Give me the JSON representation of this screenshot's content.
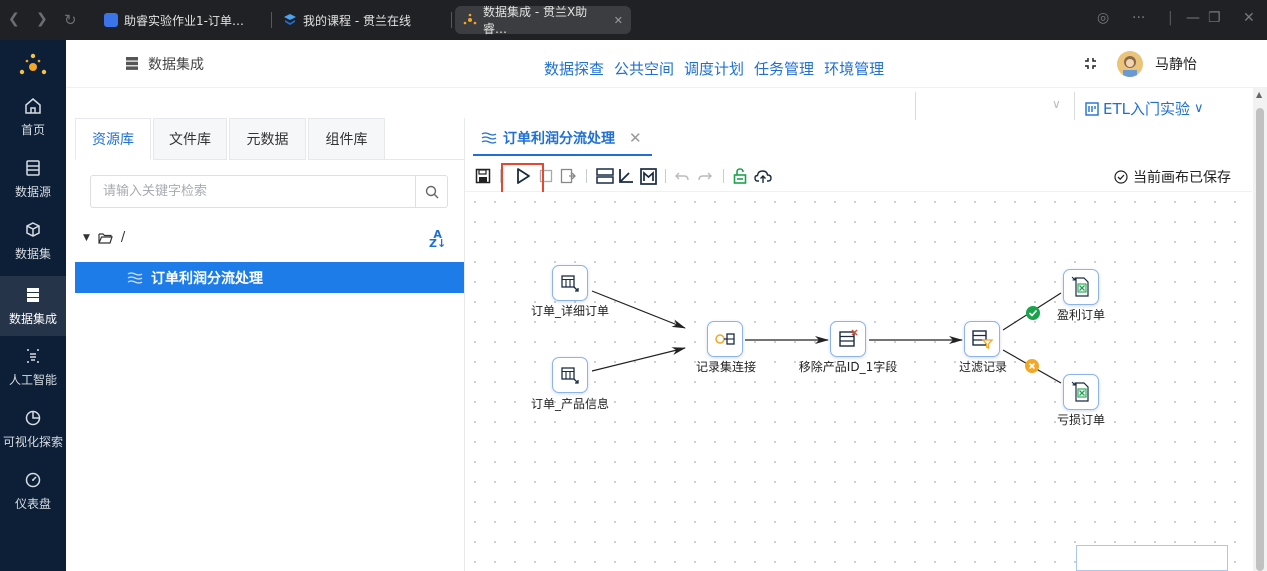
{
  "browser": {
    "tabs": [
      {
        "title": "助睿实验作业1-订单…",
        "active": false
      },
      {
        "title": "我的课程 - 贯兰在线",
        "active": false
      },
      {
        "title": "数据集成 - 贯兰X助睿…",
        "active": true
      }
    ]
  },
  "sidebar": {
    "items": [
      {
        "label": "首页",
        "icon": "home-icon"
      },
      {
        "label": "数据源",
        "icon": "datasource-icon"
      },
      {
        "label": "数据集",
        "icon": "cube-icon"
      },
      {
        "label": "数据集成",
        "icon": "server-icon",
        "active": true
      },
      {
        "label": "人工智能",
        "icon": "ai-icon"
      },
      {
        "label": "可视化探索",
        "icon": "pie-chart-icon"
      },
      {
        "label": "仪表盘",
        "icon": "gauge-icon"
      }
    ]
  },
  "header": {
    "page_title": "数据集成",
    "user_name": "马静怡",
    "menu": [
      "数据探查",
      "公共空间",
      "调度计划",
      "任务管理",
      "环境管理"
    ],
    "project": "ETL入门实验"
  },
  "left_panel": {
    "tabs": [
      "资源库",
      "文件库",
      "元数据",
      "组件库"
    ],
    "active_tab": "资源库",
    "search_placeholder": "请输入关键字检索",
    "tree_root": "/",
    "tree_item": "订单利润分流处理"
  },
  "editor": {
    "tab_title": "订单利润分流处理",
    "saved_status": "当前画布已保存",
    "nodes": [
      {
        "label": "订单_详细订单"
      },
      {
        "label": "订单_产品信息"
      },
      {
        "label": "记录集连接"
      },
      {
        "label": "移除产品ID_1字段"
      },
      {
        "label": "过滤记录"
      },
      {
        "label": "盈利订单"
      },
      {
        "label": "亏损订单"
      }
    ]
  },
  "colors": {
    "accent": "#1f6fd6",
    "sidebar_bg": "#0d1f36",
    "selected_item": "#1e7ce8",
    "highlight_box": "#e8462d",
    "true_branch": "#1aa34a",
    "false_branch": "#f5a623"
  }
}
